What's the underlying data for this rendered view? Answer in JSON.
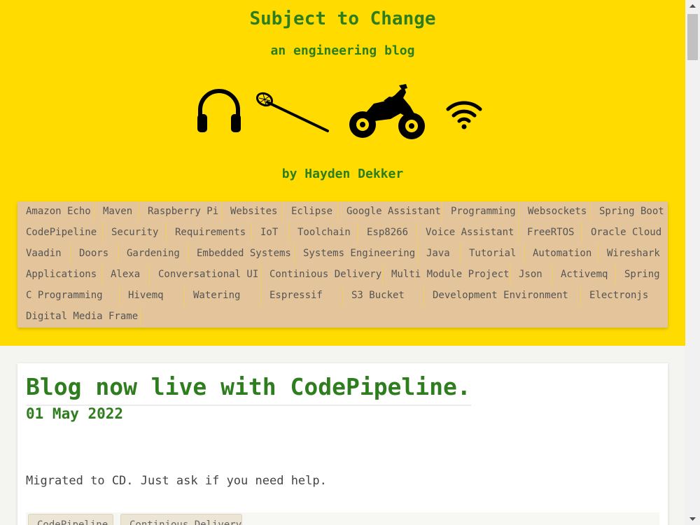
{
  "site": {
    "title": "Subject to Change",
    "subtitle": "an engineering blog",
    "byline": "by Hayden Dekker",
    "accent_color": "#ffdb00",
    "title_color": "#2e7d1e",
    "icons": [
      "headphones-icon",
      "lacrosse-stick-icon",
      "motorcycle-icon",
      "wifi-icon"
    ]
  },
  "tags": [
    "Amazon Echo",
    "Maven",
    "Raspberry Pi",
    "Websites",
    "Eclipse",
    "Google Assistant",
    "Programming",
    "Websockets",
    "Spring Boot",
    "CodePipeline",
    "Security",
    "Requirements",
    "IoT",
    "Toolchain",
    "Esp8266",
    "Voice Assistant",
    "FreeRTOS",
    "Oracle Cloud",
    "Vaadin",
    "Doors",
    "Gardening",
    "Embedded Systems",
    "Systems Engineering",
    "Java",
    "Tutorial",
    "Automation",
    "Wireshark",
    "Applications",
    "Alexa",
    "Conversational UI",
    "Continious Delivery",
    "Multi Module Project",
    "Json",
    "Activemq",
    "Spring",
    "C Programming",
    "Hivemq",
    "Watering",
    "Espressif",
    "S3 Bucket",
    "Development Environment",
    "Electronjs",
    "Digital Media Frame"
  ],
  "post": {
    "title": "Blog now live with CodePipeline.",
    "date": "01 May 2022",
    "body": "Migrated to CD. Just ask if you need help.",
    "tags": [
      "CodePipeline",
      "Continious Delivery"
    ]
  }
}
